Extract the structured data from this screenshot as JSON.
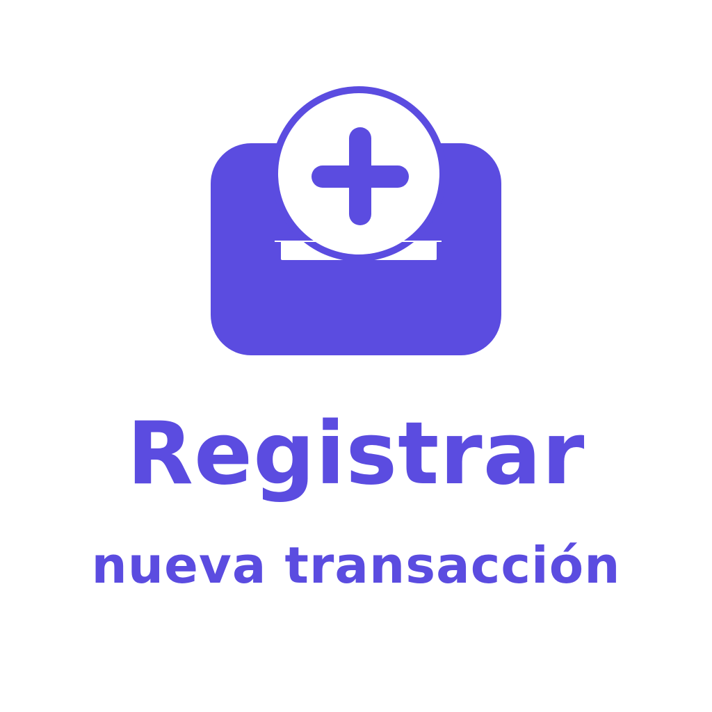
{
  "colors": {
    "accent": "#5b4ce0",
    "background": "#ffffff"
  },
  "icon": {
    "name": "wallet-add-icon"
  },
  "text": {
    "title": "Registrar",
    "subtitle": "nueva transacción"
  }
}
